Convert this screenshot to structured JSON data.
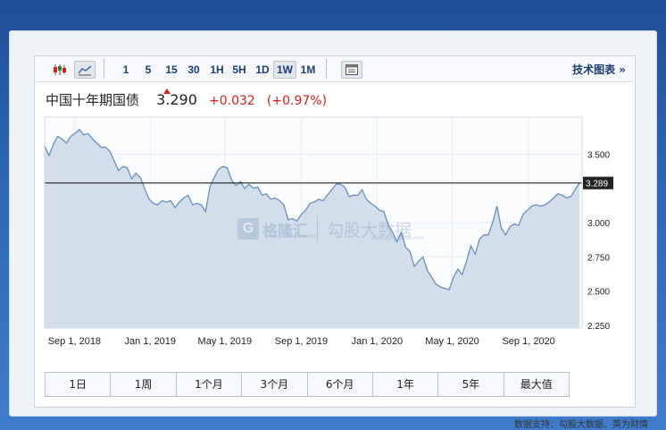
{
  "toolbar": {
    "chart_type_icons": [
      "candlestick-icon",
      "line-chart-icon"
    ],
    "active_chart_type": "line-chart-icon",
    "ranges": [
      "1",
      "5",
      "15",
      "30",
      "1H",
      "5H",
      "1D",
      "1W",
      "1M"
    ],
    "active_range": "1W",
    "settings_icon": "window-icon",
    "tech_chart_label": "技术图表 »"
  },
  "quote": {
    "name": "中国十年期国债",
    "price": "3.290",
    "change": "+0.032",
    "change_pct": "(+0.97%)",
    "up_color": "#d21f1f"
  },
  "chart_data": {
    "type": "area",
    "x_ticks": [
      "Sep 1, 2018",
      "Jan 1, 2019",
      "May 1, 2019",
      "Sep 1, 2019",
      "Jan 1, 2020",
      "May 1, 2020",
      "Sep 1, 2020"
    ],
    "y_ticks": [
      "3.500",
      "3.000",
      "2.750",
      "2.500",
      "2.250"
    ],
    "ylim": [
      2.23,
      3.77
    ],
    "current_value_label": "3.289",
    "current_value": 3.289,
    "line_color": "#6a8fbd",
    "fill_color": "#d2deea",
    "series": [
      {
        "x": [
          "2018-07-15",
          "2018-07-22",
          "2018-07-29",
          "2018-08-05",
          "2018-08-12",
          "2018-08-19",
          "2018-08-26",
          "2018-09-02",
          "2018-09-09",
          "2018-09-16",
          "2018-09-23",
          "2018-09-30",
          "2018-10-07",
          "2018-10-14",
          "2018-10-21",
          "2018-10-28",
          "2018-11-04",
          "2018-11-11",
          "2018-11-18",
          "2018-11-25",
          "2018-12-02",
          "2018-12-09",
          "2018-12-16",
          "2018-12-23",
          "2018-12-30",
          "2019-01-06",
          "2019-01-13",
          "2019-01-20",
          "2019-01-27",
          "2019-02-03",
          "2019-02-10",
          "2019-02-17",
          "2019-02-24",
          "2019-03-03",
          "2019-03-10",
          "2019-03-17",
          "2019-03-24",
          "2019-03-31",
          "2019-04-07",
          "2019-04-14",
          "2019-04-21",
          "2019-04-28",
          "2019-05-05",
          "2019-05-12",
          "2019-05-19",
          "2019-05-26",
          "2019-06-02",
          "2019-06-09",
          "2019-06-16",
          "2019-06-23",
          "2019-06-30",
          "2019-07-07",
          "2019-07-14",
          "2019-07-21",
          "2019-07-28",
          "2019-08-04",
          "2019-08-11",
          "2019-08-18",
          "2019-08-25",
          "2019-09-01",
          "2019-09-08",
          "2019-09-15",
          "2019-09-22",
          "2019-09-29",
          "2019-10-06",
          "2019-10-13",
          "2019-10-20",
          "2019-10-27",
          "2019-11-03",
          "2019-11-10",
          "2019-11-17",
          "2019-11-24",
          "2019-12-01",
          "2019-12-08",
          "2019-12-15",
          "2019-12-22",
          "2019-12-29",
          "2020-01-05",
          "2020-01-12",
          "2020-01-19",
          "2020-01-26",
          "2020-02-02",
          "2020-02-09",
          "2020-02-16",
          "2020-02-23",
          "2020-03-01",
          "2020-03-08",
          "2020-03-15",
          "2020-03-22",
          "2020-03-29",
          "2020-04-05",
          "2020-04-12",
          "2020-04-19",
          "2020-04-26",
          "2020-05-03",
          "2020-05-10",
          "2020-05-17",
          "2020-05-24",
          "2020-05-31",
          "2020-06-07",
          "2020-06-14",
          "2020-06-21",
          "2020-06-28",
          "2020-07-05",
          "2020-07-12",
          "2020-07-19",
          "2020-07-26",
          "2020-08-02",
          "2020-08-09",
          "2020-08-16",
          "2020-08-23",
          "2020-08-30",
          "2020-09-06",
          "2020-09-13",
          "2020-09-20",
          "2020-09-27",
          "2020-10-04",
          "2020-10-11",
          "2020-10-18",
          "2020-10-25",
          "2020-11-01",
          "2020-11-08",
          "2020-11-15",
          "2020-11-22"
        ],
        "values": [
          3.56,
          3.49,
          3.57,
          3.63,
          3.61,
          3.58,
          3.63,
          3.65,
          3.68,
          3.64,
          3.65,
          3.61,
          3.58,
          3.55,
          3.55,
          3.52,
          3.45,
          3.38,
          3.41,
          3.4,
          3.32,
          3.36,
          3.33,
          3.25,
          3.17,
          3.14,
          3.13,
          3.16,
          3.15,
          3.16,
          3.11,
          3.15,
          3.18,
          3.2,
          3.13,
          3.14,
          3.13,
          3.08,
          3.26,
          3.33,
          3.39,
          3.41,
          3.4,
          3.31,
          3.27,
          3.3,
          3.25,
          3.28,
          3.25,
          3.26,
          3.2,
          3.21,
          3.17,
          3.18,
          3.16,
          3.13,
          3.02,
          3.03,
          3.01,
          3.06,
          3.09,
          3.14,
          3.15,
          3.17,
          3.16,
          3.2,
          3.24,
          3.28,
          3.28,
          3.26,
          3.19,
          3.2,
          3.2,
          3.24,
          3.17,
          3.14,
          3.12,
          3.09,
          3.08,
          2.98,
          2.93,
          2.86,
          2.93,
          2.82,
          2.79,
          2.68,
          2.72,
          2.75,
          2.65,
          2.6,
          2.55,
          2.53,
          2.52,
          2.51,
          2.6,
          2.66,
          2.62,
          2.72,
          2.83,
          2.77,
          2.88,
          2.91,
          2.91,
          3.0,
          3.12,
          2.96,
          2.91,
          2.97,
          2.99,
          2.98,
          3.06,
          3.09,
          3.12,
          3.13,
          3.12,
          3.13,
          3.15,
          3.18,
          3.21,
          3.2,
          3.18,
          3.19,
          3.24,
          3.29
        ]
      }
    ]
  },
  "bottom_tabs": [
    "1日",
    "1周",
    "1个月",
    "3个月",
    "6个月",
    "1年",
    "5年",
    "最大值"
  ],
  "watermark": {
    "brand1": "格隆汇",
    "brand1_url": "www.gelonghui.com",
    "brand2": "勾股大数据",
    "brand2_url": "www.gogudata.com"
  },
  "footer": "数据支持：勾股大数据、英为财情"
}
